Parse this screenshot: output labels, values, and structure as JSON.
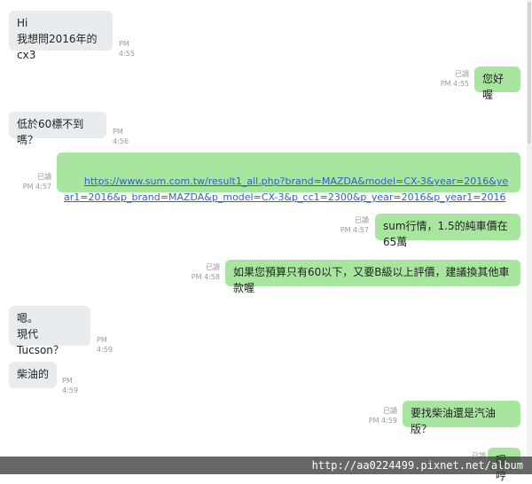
{
  "messages": [
    {
      "dir": "in",
      "text": "Hi\n我想問2016年的cx3",
      "time": "PM 4:55"
    },
    {
      "dir": "out",
      "text": "您好喔",
      "read": "已讀",
      "time": "PM 4:55"
    },
    {
      "dir": "in",
      "text": "低於60標不到嗎？",
      "time": "PM 4:56"
    },
    {
      "dir": "out",
      "link": "https://www.sum.com.tw/result1_all.php?brand=MAZDA&model=CX-3&year=2016&year1=2016&p_brand=MAZDA&p_model=CX-3&p_cc1=2300&p_year=2016&p_year1=2016",
      "read": "已讀",
      "time": "PM 4:57"
    },
    {
      "dir": "out",
      "text": "sum行情，1.5的純車價在65萬",
      "read": "已讀",
      "time": "PM 4:57"
    },
    {
      "dir": "out",
      "text": "如果您預算只有60以下，又要B級以上評價，建議換其他車款喔",
      "read": "已讀",
      "time": "PM 4:58"
    },
    {
      "dir": "in",
      "text": "嗯。\n現代Tucson？",
      "time": "PM 4:59"
    },
    {
      "dir": "in",
      "text": "柴油的",
      "time": "PM 4:59"
    },
    {
      "dir": "out",
      "text": "要找柴油還是汽油版？",
      "read": "已讀",
      "time": "PM 4:59"
    },
    {
      "dir": "out",
      "text": "嗯哼",
      "read": "已讀",
      "time": ""
    }
  ],
  "watermark": "http://aa0224499.pixnet.net/album",
  "colors": {
    "incoming_bubble": "#e9ecef",
    "outgoing_bubble": "#a8e6a0",
    "link": "#2f5fcf"
  }
}
